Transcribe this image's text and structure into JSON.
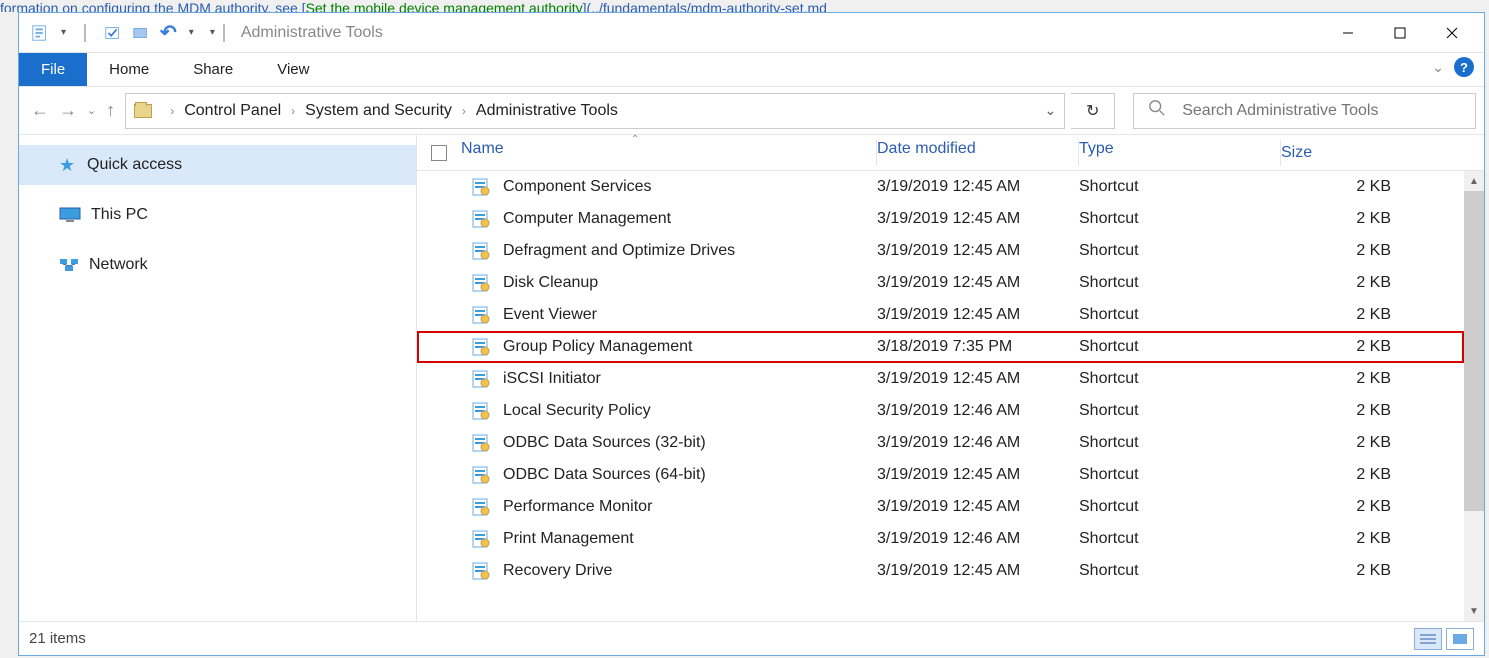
{
  "window_title": "Administrative Tools",
  "ribbon_tabs": [
    "File",
    "Home",
    "Share",
    "View"
  ],
  "breadcrumb": [
    "Control Panel",
    "System and Security",
    "Administrative Tools"
  ],
  "search_placeholder": "Search Administrative Tools",
  "sidebar": {
    "quick_access": "Quick access",
    "this_pc": "This PC",
    "network": "Network"
  },
  "columns": {
    "name": "Name",
    "date": "Date modified",
    "type": "Type",
    "size": "Size"
  },
  "rows": [
    {
      "name": "Component Services",
      "date": "3/19/2019 12:45 AM",
      "type": "Shortcut",
      "size": "2 KB",
      "hl": false
    },
    {
      "name": "Computer Management",
      "date": "3/19/2019 12:45 AM",
      "type": "Shortcut",
      "size": "2 KB",
      "hl": false
    },
    {
      "name": "Defragment and Optimize Drives",
      "date": "3/19/2019 12:45 AM",
      "type": "Shortcut",
      "size": "2 KB",
      "hl": false
    },
    {
      "name": "Disk Cleanup",
      "date": "3/19/2019 12:45 AM",
      "type": "Shortcut",
      "size": "2 KB",
      "hl": false
    },
    {
      "name": "Event Viewer",
      "date": "3/19/2019 12:45 AM",
      "type": "Shortcut",
      "size": "2 KB",
      "hl": false
    },
    {
      "name": "Group Policy Management",
      "date": "3/18/2019 7:35 PM",
      "type": "Shortcut",
      "size": "2 KB",
      "hl": true
    },
    {
      "name": "iSCSI Initiator",
      "date": "3/19/2019 12:45 AM",
      "type": "Shortcut",
      "size": "2 KB",
      "hl": false
    },
    {
      "name": "Local Security Policy",
      "date": "3/19/2019 12:46 AM",
      "type": "Shortcut",
      "size": "2 KB",
      "hl": false
    },
    {
      "name": "ODBC Data Sources (32-bit)",
      "date": "3/19/2019 12:46 AM",
      "type": "Shortcut",
      "size": "2 KB",
      "hl": false
    },
    {
      "name": "ODBC Data Sources (64-bit)",
      "date": "3/19/2019 12:45 AM",
      "type": "Shortcut",
      "size": "2 KB",
      "hl": false
    },
    {
      "name": "Performance Monitor",
      "date": "3/19/2019 12:45 AM",
      "type": "Shortcut",
      "size": "2 KB",
      "hl": false
    },
    {
      "name": "Print Management",
      "date": "3/19/2019 12:46 AM",
      "type": "Shortcut",
      "size": "2 KB",
      "hl": false
    },
    {
      "name": "Recovery Drive",
      "date": "3/19/2019 12:45 AM",
      "type": "Shortcut",
      "size": "2 KB",
      "hl": false
    }
  ],
  "status_text": "21 items"
}
